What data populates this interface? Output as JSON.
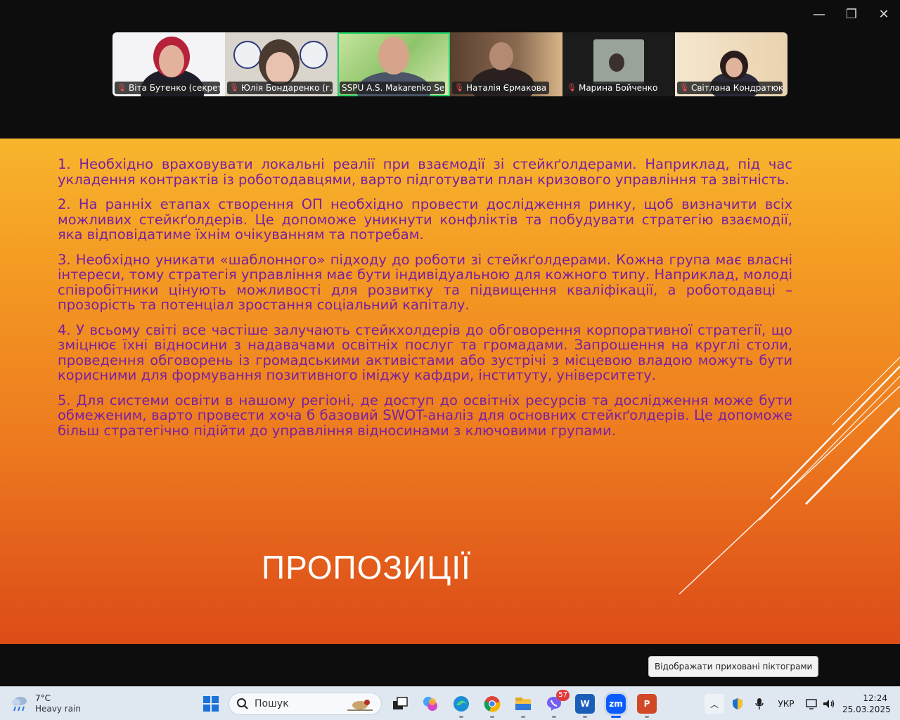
{
  "window": {
    "min_glyph": "—",
    "max_glyph": "❐",
    "close_glyph": "✕"
  },
  "participants": [
    {
      "name": "Віта Бутенко (секрета...",
      "muted": true,
      "active": false
    },
    {
      "name": "Юлія Бондаренко (г...",
      "muted": true,
      "active": false
    },
    {
      "name": "SSPU A.S. Makarenko Se...",
      "muted": false,
      "active": true
    },
    {
      "name": "Наталія  Єрмакова",
      "muted": true,
      "active": false
    },
    {
      "name": "Марина Бойченко",
      "muted": true,
      "active": false
    },
    {
      "name": "Світлана Кондратюк",
      "muted": true,
      "active": false
    }
  ],
  "slide": {
    "paragraphs": [
      "1. Необхідно враховувати локальні реалії при взаємодії зі стейкґолдерами. Наприклад, під час укладення контрактів із роботодавцями, варто підготувати план кризового управління та звітність.",
      "2. На ранніх етапах створення ОП необхідно провести дослідження ринку, щоб визначити всіх можливих стейкґолдерів. Це допоможе уникнути конфліктів та побудувати стратегію взаємодії, яка відповідатиме їхнім очікуванням та потребам.",
      "3. Необхідно уникати «шаблонного» підходу до роботи зі стейкґолдерами. Кожна група має власні інтереси, тому стратегія управління має бути індивідуальною для кожного типу. Наприклад, молоді співробітники цінують можливості для розвитку та підвищення кваліфікації, а роботодавці – прозорість та потенціал зростання соціальний капіталу.",
      "4. У всьому світі все частіше залучають стейкхолдерів до обговорення корпоративної стратегії, що зміцнює їхні відносини з надавачами освітніх послуг та громадами. Запрошення на круглі столи, проведення обговорень із громадськими активістами або зустрічі з місцевою владою можуть бути корисними для формування позитивного іміджу кафдри, інституту, університету.",
      "5. Для системи освіти в нашому регіоні, де доступ до освітніх ресурсів та дослідження може бути обмеженим, варто провести хоча б базовий SWOT-аналіз для основних стейкґолдерів. Це допоможе більш стратегічно підійти до управління відносинами з ключовими групами."
    ],
    "title": "ПРОПОЗИЦІЇ",
    "colors": {
      "text": "#7a1fa2",
      "bg_top": "#f8b52c",
      "bg_bottom": "#dc4d17"
    }
  },
  "tooltip": "Відображати приховані піктограми",
  "taskbar": {
    "weather": {
      "temp": "7°C",
      "desc": "Heavy rain",
      "icon": "rain-cloud-icon"
    },
    "search_placeholder": "Пошук",
    "apps": [
      {
        "name": "start",
        "icon": "windows-icon"
      },
      {
        "name": "task-view",
        "icon": "task-view-icon"
      },
      {
        "name": "copilot",
        "icon": "copilot-icon"
      },
      {
        "name": "edge",
        "icon": "edge-icon"
      },
      {
        "name": "chrome",
        "icon": "chrome-icon"
      },
      {
        "name": "explorer",
        "icon": "folder-icon"
      },
      {
        "name": "viber",
        "icon": "viber-icon",
        "badge": "57"
      },
      {
        "name": "word",
        "icon": "word-icon",
        "label": "W"
      },
      {
        "name": "zoom",
        "icon": "zoom-icon",
        "label": "zm"
      },
      {
        "name": "powerpoint",
        "icon": "powerpoint-icon",
        "label": "P"
      }
    ],
    "language": "УКР",
    "time": "12:24",
    "date": "25.03.2025"
  }
}
